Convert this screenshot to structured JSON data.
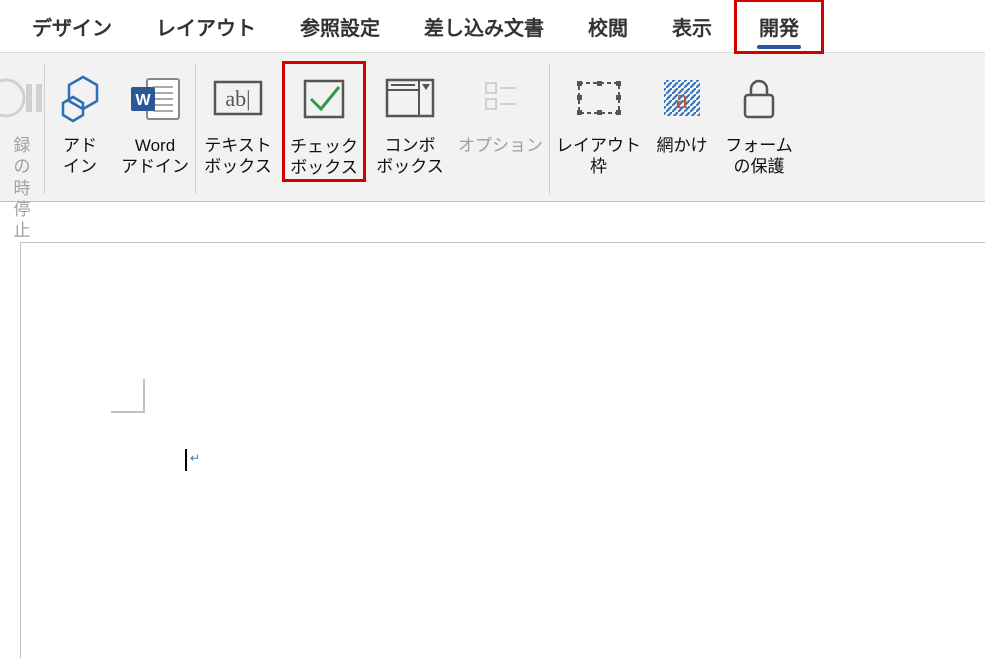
{
  "tabs": {
    "design": "デザイン",
    "layout": "レイアウト",
    "references": "参照設定",
    "mailings": "差し込み文書",
    "review": "校閲",
    "view": "表示",
    "developer": "開発"
  },
  "ribbon": {
    "stop_recording_l1": "録の",
    "stop_recording_l2": "時停止",
    "addins_l1": "アド",
    "addins_l2": "イン",
    "word_addins_l1": "Word",
    "word_addins_l2": "アドイン",
    "textbox_l1": "テキスト",
    "textbox_l2": "ボックス",
    "checkbox_l1": "チェック",
    "checkbox_l2": "ボックス",
    "combobox_l1": "コンボ",
    "combobox_l2": "ボックス",
    "options": "オプション",
    "layoutframe_l1": "レイアウト",
    "layoutframe_l2": "枠",
    "shading": "網かけ",
    "protect_l1": "フォーム",
    "protect_l2": "の保護"
  }
}
